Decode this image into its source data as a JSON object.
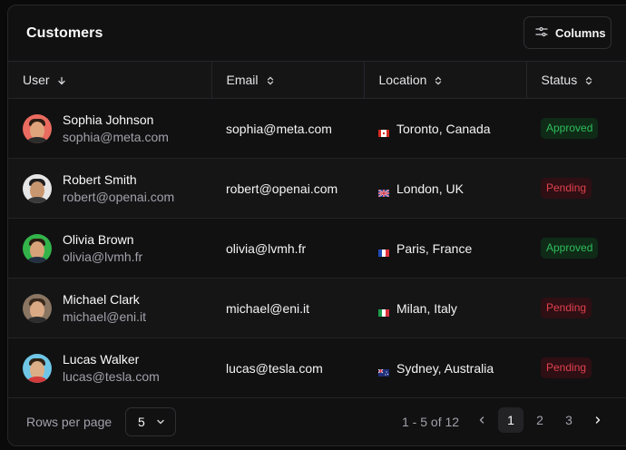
{
  "header": {
    "title": "Customers",
    "columns_button": "Columns"
  },
  "columns": [
    "User",
    "Email",
    "Location",
    "Status"
  ],
  "rows": [
    {
      "name": "Sophia Johnson",
      "user_email": "sophia@meta.com",
      "email": "sophia@meta.com",
      "location": "Toronto, Canada",
      "flag": "canada-flag",
      "status": "Approved"
    },
    {
      "name": "Robert Smith",
      "user_email": "robert@openai.com",
      "email": "robert@openai.com",
      "location": "London, UK",
      "flag": "uk-flag",
      "status": "Pending"
    },
    {
      "name": "Olivia Brown",
      "user_email": "olivia@lvmh.fr",
      "email": "olivia@lvmh.fr",
      "location": "Paris, France",
      "flag": "france-flag",
      "status": "Approved"
    },
    {
      "name": "Michael Clark",
      "user_email": "michael@eni.it",
      "email": "michael@eni.it",
      "location": "Milan, Italy",
      "flag": "italy-flag",
      "status": "Pending"
    },
    {
      "name": "Lucas Walker",
      "user_email": "lucas@tesla.com",
      "email": "lucas@tesla.com",
      "location": "Sydney, Australia",
      "flag": "australia-flag",
      "status": "Pending"
    }
  ],
  "footer": {
    "rows_per_page_label": "Rows per page",
    "rows_per_page_value": "5",
    "range": "1 - 5 of 12",
    "pages": [
      "1",
      "2",
      "3"
    ],
    "current_page": "1"
  },
  "colors": {
    "approved_text": "#2fbe5b",
    "approved_bg": "#0f2a17",
    "pending_text": "#e0414e",
    "pending_bg": "#2e0f13",
    "avatar_backgrounds": [
      "#ea6b5f",
      "#e6e6e6",
      "#33b34a",
      "#8a7563",
      "#6fc6e6"
    ]
  }
}
